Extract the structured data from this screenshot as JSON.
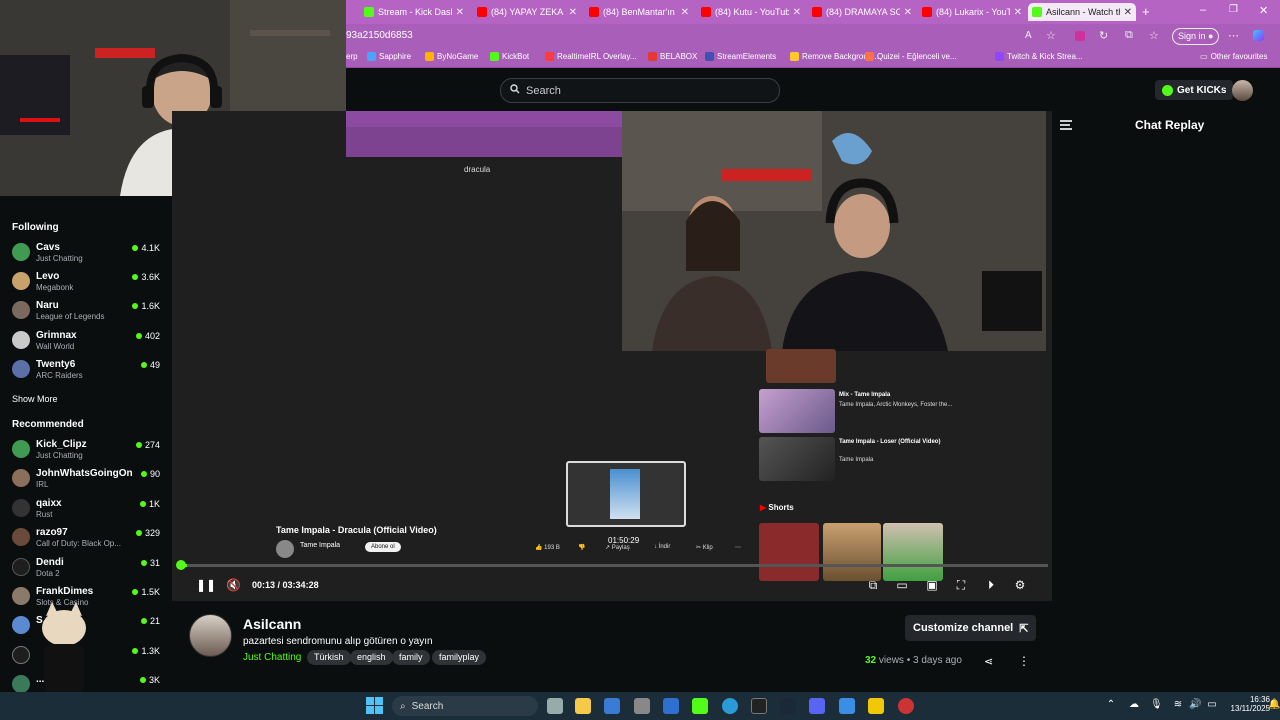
{
  "browser": {
    "tabs": [
      {
        "label": "Stream - Kick Dashb",
        "color": "#53fc18"
      },
      {
        "label": "(84) YAPAY ZEKA KA",
        "color": "#ff0000"
      },
      {
        "label": "(84) BenMantar'ın g",
        "color": "#ff0000"
      },
      {
        "label": "(84) Kutu - YouTube",
        "color": "#ff0000"
      },
      {
        "label": "(84) DRAMAYA SON",
        "color": "#ff0000"
      },
      {
        "label": "(84) Lukarix - YouT",
        "color": "#ff0000"
      },
      {
        "label": "Asilcann - Watch th",
        "color": "#53fc18"
      }
    ],
    "address": "93a2150d6853",
    "sign_in": "Sign in",
    "bookmarks": [
      "erp",
      "Sapphire",
      "ByNoGame",
      "KickBot",
      "RealtimeIRL Overlay...",
      "BELABOX",
      "StreamElements",
      "Remove Backgroun...",
      "Quizei - Eğlenceli ve...",
      "Twitch & Kick Strea..."
    ],
    "other_favourites": "Other favourites"
  },
  "header": {
    "search_placeholder": "Search",
    "get_kicks": "Get KICKs"
  },
  "sidebar": {
    "following_title": "Following",
    "following": [
      {
        "name": "Cavs",
        "category": "Just Chatting",
        "viewers": "4.1K",
        "color": "#3f9b52"
      },
      {
        "name": "Levo",
        "category": "Megabonk",
        "viewers": "3.6K",
        "color": "#c8a26a"
      },
      {
        "name": "Naru",
        "category": "League of Legends",
        "viewers": "1.6K",
        "color": "#7a6a5e"
      },
      {
        "name": "Grimnax",
        "category": "Wall World",
        "viewers": "402",
        "color": "#c9c9c9"
      },
      {
        "name": "Twenty6",
        "category": "ARC Raiders",
        "viewers": "49",
        "color": "#5b6fa8"
      }
    ],
    "show_more": "Show More",
    "recommended_title": "Recommended",
    "recommended": [
      {
        "name": "Kick_Clipz",
        "category": "Just Chatting",
        "viewers": "274",
        "color": "#3f9b52"
      },
      {
        "name": "JohnWhatsGoingOn",
        "category": "IRL",
        "viewers": "90",
        "color": "#8b6f5b"
      },
      {
        "name": "qaixx",
        "category": "Rust",
        "viewers": "1K",
        "color": "#222222"
      },
      {
        "name": "razo97",
        "category": "Call of Duty: Black Op...",
        "viewers": "329",
        "color": "#6a4a3a"
      },
      {
        "name": "Dendi",
        "category": "Dota 2",
        "viewers": "31",
        "color": "#1e1e1e"
      },
      {
        "name": "FrankDimes",
        "category": "Slots & Casino",
        "viewers": "1.5K",
        "color": "#8a7a6a"
      },
      {
        "name": "S...lay",
        "category": "",
        "viewers": "21",
        "color": "#5a8ad0"
      },
      {
        "name": "",
        "category": "",
        "viewers": "1.3K",
        "color": "#1e1e1e"
      },
      {
        "name": "...y",
        "category": "",
        "viewers": "3K",
        "color": "#3a7a5a"
      }
    ]
  },
  "player": {
    "video_title": "Tame Impala - Dracula (Official Video)",
    "channel": "Tame Impala",
    "subscribe": "Abone ol",
    "likes": "193 B",
    "share": "Paylaş",
    "download": "İndir",
    "clip": "Klip",
    "popup_time": "01:50:29",
    "search_text": "dracula",
    "shorts": "Shorts",
    "side_videos": [
      {
        "title": "Mix - Tame Impala",
        "meta": "Tame Impala, Arctic Monkeys, Foster the..."
      },
      {
        "title": "Tame Impala - Loser (Official Video)",
        "meta": "Tame Impala"
      }
    ],
    "time_current": "00:13",
    "time_total": "03:34:28",
    "progress": 0.006
  },
  "chat": {
    "title": "Chat Replay"
  },
  "channel": {
    "name": "Asilcann",
    "title": "pazartesi sendromunu alıp götüren o yayın",
    "category": "Just Chatting",
    "tags": [
      "Türkish",
      "english",
      "family",
      "familyplay"
    ],
    "customize": "Customize channel",
    "views_count": "32",
    "views_label": "views",
    "ago": "3 days ago"
  },
  "taskbar": {
    "search": "Search",
    "time": "16:36",
    "date": "13/11/2025"
  }
}
